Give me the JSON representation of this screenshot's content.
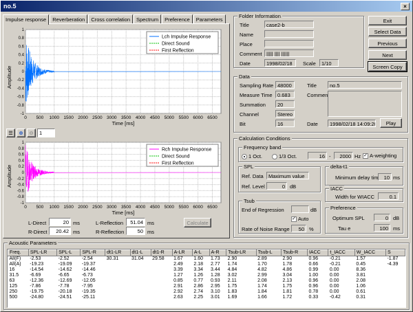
{
  "window": {
    "title": "no.5",
    "close": "×"
  },
  "tabs": [
    "Impulse response",
    "Reverberation",
    "Cross correlation",
    "Spectrum",
    "Preference",
    "Parameters"
  ],
  "plot_top": {
    "ylabel": "Amplitude",
    "xlabel": "Time [ms]",
    "xticks": [
      "0",
      "500",
      "1000",
      "1500",
      "2000",
      "2500",
      "3000",
      "3500",
      "4000",
      "4500",
      "5000",
      "5500",
      "6000",
      "6500"
    ],
    "yticks": [
      "1",
      "0.8",
      "0.6",
      "0.4",
      "0.2",
      "0",
      "-0.2",
      "-0.4",
      "-0.6",
      "-0.8",
      "-1"
    ],
    "legend": [
      "Lch Impulse Response",
      "Direct Sound",
      "First Reflection"
    ],
    "colors": [
      "#0070ff",
      "#00c000",
      "#ff0000"
    ]
  },
  "plot_bottom": {
    "ylabel": "Amplitude",
    "xlabel": "Time [ms]",
    "xticks": [
      "0",
      "500",
      "1000",
      "1500",
      "2000",
      "2500",
      "3000",
      "3500",
      "4000",
      "4500",
      "5000",
      "5500",
      "6000",
      "6500"
    ],
    "yticks": [
      "1",
      "0.8",
      "0.6",
      "0.4",
      "0.2",
      "0",
      "-0.2",
      "-0.4",
      "-0.6",
      "-0.8",
      "-1"
    ],
    "legend": [
      "Rch Impulse Response",
      "Direct Sound",
      "First Reflection"
    ],
    "colors": [
      "#ff00ff",
      "#00c000",
      "#ff0000"
    ]
  },
  "zoom_value": "1",
  "lower": {
    "l_direct_label": "L-Direct",
    "l_direct": "20",
    "r_direct_label": "R-Direct",
    "r_direct": "20.42",
    "l_refl_label": "L-Reflection",
    "l_refl": "51.04",
    "r_refl_label": "R-Reflection",
    "r_refl": "50",
    "unit": "ms",
    "calculate": "Calculate"
  },
  "folder": {
    "title": "Folder Information",
    "title_label": "Title",
    "title_value": "case2-b",
    "name_label": "Name",
    "place_label": "Place",
    "comment_label": "Comment",
    "comment_value": "|||||  |||| ||||||",
    "date_label": "Date",
    "date_value": "1998/02/18",
    "scale_label": "Scale",
    "scale_value": "1/10"
  },
  "buttons": {
    "exit": "Exit",
    "select": "Select Data",
    "previous": "Previous",
    "next": "Next",
    "screen": "Screen Copy"
  },
  "data": {
    "title": "Data",
    "sr_label": "Sampling Rate",
    "sr": "48000",
    "mt_label": "Measure Time",
    "mt": "0.683",
    "sum_label": "Summation",
    "sum": "20",
    "ch_label": "Channel",
    "ch": "Stereo",
    "bit_label": "Bit",
    "bit": "16",
    "title_label": "Title",
    "title_value": "no.5",
    "comment_label": "Comment",
    "date_label": "Date",
    "date_value": "1998/02/18 14:09:20",
    "play": "Play"
  },
  "calc": {
    "title": "Calculation Conditions",
    "fb": "Frequency band",
    "oct1": "1 Oct.",
    "oct3": "1/3 Oct.",
    "f1": "16",
    "tilde": "-",
    "f2": "2000",
    "hz": "Hz",
    "aw": "A-weighting",
    "spl": "SPL",
    "ref_data_label": "Ref. Data",
    "ref_data": "Maximum value",
    "ref_level_label": "Ref. Level",
    "ref_level": "0",
    "db": "dB",
    "delta": "delta-t1",
    "min_delay_label": "Minimum delay time",
    "min_delay": "10",
    "ms": "ms",
    "iacc": "IACC",
    "wiacc_label": "Width for WIACC",
    "wiacc": "0.1",
    "tsub": "Tsub",
    "eor_label": "End of Regression",
    "auto": "Auto",
    "rnr_label": "Rate of Noise Range",
    "rnr": "50",
    "pct": "%",
    "pref": "Preference",
    "opt_label": "Optimum SPL",
    "opt": "0",
    "tau_label": "Tau e",
    "tau": "100"
  },
  "acoustic": {
    "title": "Acoustic Parameters",
    "headers": [
      "Freq.",
      "SPL-LR",
      "SPL-L",
      "SPL-R",
      "dt1-LR",
      "dt1-L",
      "dt1-R",
      "A-LR",
      "A-L",
      "A-R",
      "Tsub-LR",
      "Tsub-L",
      "Tsub-R",
      "IACC",
      "t_IACC",
      "W_IACC",
      "S"
    ],
    "rows": [
      [
        "All(F)",
        "-2.53",
        "-2.52",
        "-2.54",
        "30.31",
        "31.04",
        "29.58",
        "1.67",
        "1.60",
        "1.73",
        "2.90",
        "2.89",
        "2.90",
        "0.96",
        "-0.21",
        "1.57",
        "-1.87"
      ],
      [
        "All(A)",
        "-19.23",
        "-19.09",
        "-19.37",
        "",
        "",
        "",
        "2.49",
        "2.18",
        "2.77",
        "1.74",
        "1.70",
        "1.78",
        "0.66",
        "-0.21",
        "0.45",
        "-4.39"
      ],
      [
        "16",
        "-14.54",
        "-14.62",
        "-14.46",
        "",
        "",
        "",
        "3.39",
        "3.34",
        "3.44",
        "4.84",
        "4.82",
        "4.86",
        "0.99",
        "0.00",
        "8.36",
        ""
      ],
      [
        "31.5",
        "-6.69",
        "-6.65",
        "-6.73",
        "",
        "",
        "",
        "1.27",
        "1.26",
        "1.28",
        "3.02",
        "2.99",
        "3.04",
        "1.00",
        "0.00",
        "3.81",
        ""
      ],
      [
        "63",
        "-12.36",
        "-12.69",
        "-12.05",
        "",
        "",
        "",
        "0.85",
        "0.77",
        "0.93",
        "2.11",
        "2.08",
        "2.13",
        "0.96",
        "0.00",
        "2.08",
        ""
      ],
      [
        "125",
        "-7.86",
        "-7.78",
        "-7.95",
        "",
        "",
        "",
        "2.91",
        "2.86",
        "2.95",
        "1.75",
        "1.74",
        "1.75",
        "0.96",
        "0.00",
        "1.06",
        ""
      ],
      [
        "250",
        "-19.75",
        "-20.18",
        "-19.35",
        "",
        "",
        "",
        "2.92",
        "2.74",
        "3.10",
        "1.83",
        "1.84",
        "1.81",
        "0.78",
        "0.00",
        "0.61",
        ""
      ],
      [
        "500",
        "-24.80",
        "-24.51",
        "-25.11",
        "",
        "",
        "",
        "2.63",
        "2.25",
        "3.01",
        "1.69",
        "1.66",
        "1.72",
        "0.33",
        "-0.42",
        "0.31",
        ""
      ]
    ]
  }
}
